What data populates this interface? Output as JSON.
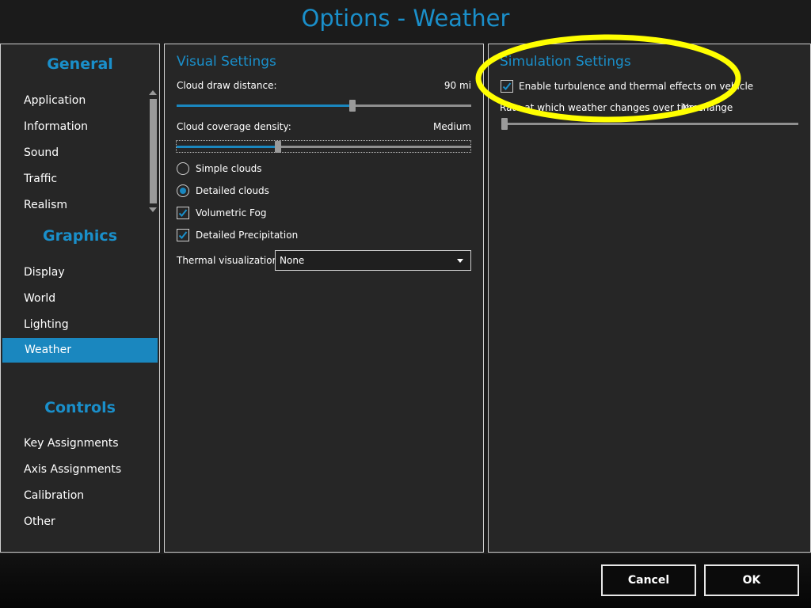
{
  "window": {
    "title": "Options - Weather"
  },
  "sidebar": {
    "categories": [
      {
        "label": "General",
        "items": [
          "Application",
          "Information",
          "Sound",
          "Traffic",
          "Realism"
        ]
      },
      {
        "label": "Graphics",
        "items": [
          "Display",
          "World",
          "Lighting",
          "Weather"
        ]
      },
      {
        "label": "Controls",
        "items": [
          "Key Assignments",
          "Axis Assignments",
          "Calibration",
          "Other"
        ]
      }
    ],
    "selected_item": "Weather"
  },
  "visual_settings": {
    "title": "Visual Settings",
    "cloud_draw_distance": {
      "label": "Cloud draw distance:",
      "value": "90 mi",
      "slider_fraction": 0.6
    },
    "cloud_coverage_density": {
      "label": "Cloud coverage density:",
      "value": "Medium",
      "slider_fraction": 0.34
    },
    "cloud_type": {
      "options": [
        {
          "label": "Simple clouds",
          "selected": false
        },
        {
          "label": "Detailed clouds",
          "selected": true
        }
      ]
    },
    "volumetric_fog": {
      "label": "Volumetric Fog",
      "checked": true
    },
    "detailed_precipitation": {
      "label": "Detailed Precipitation",
      "checked": true
    },
    "thermal_visualization": {
      "label": "Thermal visualization:",
      "value": "None"
    }
  },
  "simulation_settings": {
    "title": "Simulation Settings",
    "turbulence": {
      "label": "Enable turbulence and thermal effects on vehicle",
      "checked": true
    },
    "weather_change_rate": {
      "label": "Rate at which weather changes over time:",
      "value": "No change",
      "slider_fraction": 0.0
    }
  },
  "buttons": {
    "cancel": "Cancel",
    "ok": "OK"
  },
  "colors": {
    "accent": "#1a8fca",
    "selection": "#1a87bf",
    "annotation": "#ffff00",
    "panel": "#262626"
  }
}
